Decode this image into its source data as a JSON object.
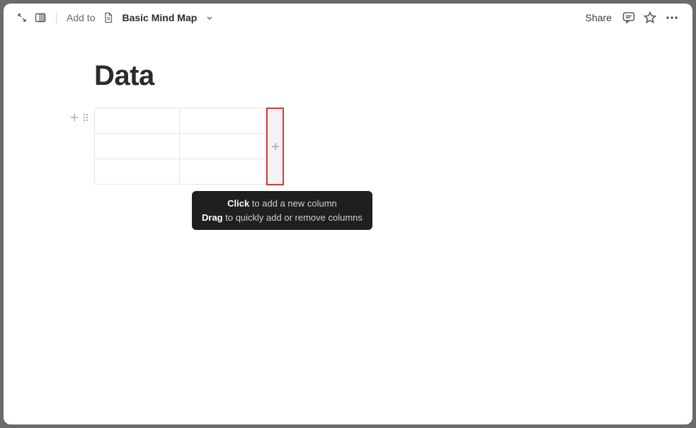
{
  "topbar": {
    "addto_label": "Add to",
    "breadcrumb_title": "Basic Mind Map",
    "share_label": "Share"
  },
  "page": {
    "title": "Data"
  },
  "table": {
    "rows": 3,
    "cols": 2
  },
  "tooltip": {
    "click_bold": "Click",
    "click_rest": " to add a new column",
    "drag_bold": "Drag",
    "drag_rest": " to quickly add or remove columns"
  }
}
